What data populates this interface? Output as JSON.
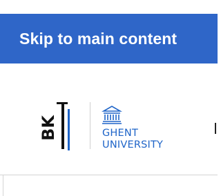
{
  "skip_link": {
    "label": "Skip to main content"
  },
  "logo": {
    "bk_text": "BK",
    "university_line1": "GHENT",
    "university_line2": "UNIVERSITY",
    "icon": "building-icon"
  },
  "colors": {
    "skip_background": "#2f66c8",
    "skip_text": "#ffffff",
    "ugent_blue": "#1e64c8",
    "logo_black": "#111111",
    "divider": "#d4d4d4"
  },
  "nav": {
    "peek_icon": "menu-edge"
  }
}
